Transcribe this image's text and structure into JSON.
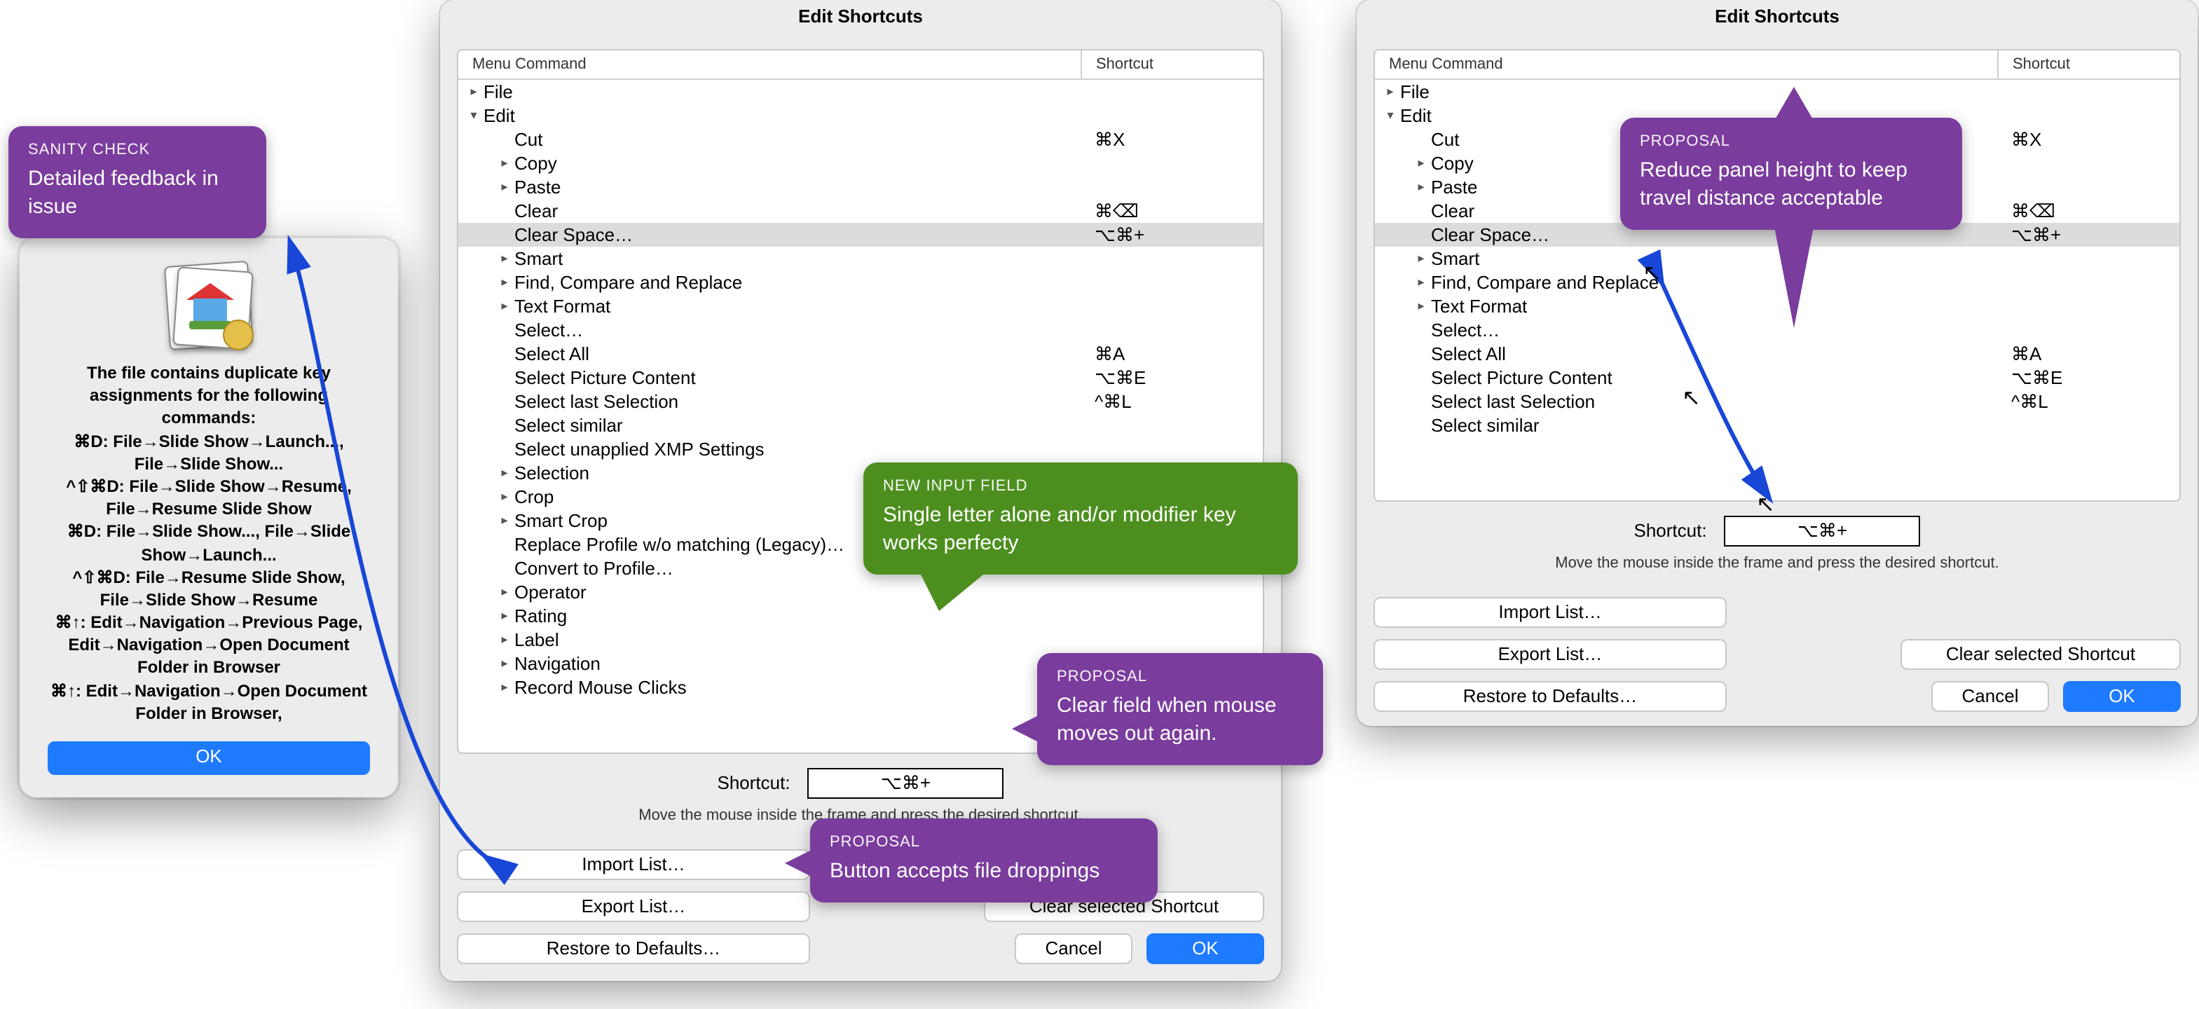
{
  "window_title": "Edit Shortcuts",
  "columns": {
    "menu": "Menu Command",
    "shortcut": "Shortcut"
  },
  "shortcut_label": "Shortcut:",
  "shortcut_value": "⌥⌘+",
  "help_text": "Move the mouse inside the frame and press the desired shortcut.",
  "buttons": {
    "import": "Import List…",
    "export": "Export List…",
    "restore": "Restore to Defaults…",
    "clear_sel": "Clear selected Shortcut",
    "cancel": "Cancel",
    "ok": "OK"
  },
  "tree_full": [
    {
      "d": 0,
      "t": "r",
      "l": "File",
      "sc": ""
    },
    {
      "d": 0,
      "t": "d",
      "l": "Edit",
      "sc": ""
    },
    {
      "d": 1,
      "t": "",
      "l": "Cut",
      "sc": "⌘X"
    },
    {
      "d": 1,
      "t": "r",
      "l": "Copy",
      "sc": ""
    },
    {
      "d": 1,
      "t": "r",
      "l": "Paste",
      "sc": ""
    },
    {
      "d": 1,
      "t": "",
      "l": "Clear",
      "sc": "⌘⌫"
    },
    {
      "d": 1,
      "t": "",
      "l": "Clear Space…",
      "sc": "⌥⌘+",
      "sel": true
    },
    {
      "d": 1,
      "t": "r",
      "l": "Smart",
      "sc": ""
    },
    {
      "d": 1,
      "t": "r",
      "l": "Find, Compare and Replace",
      "sc": ""
    },
    {
      "d": 1,
      "t": "r",
      "l": "Text Format",
      "sc": ""
    },
    {
      "d": 1,
      "t": "",
      "l": "Select…",
      "sc": ""
    },
    {
      "d": 1,
      "t": "",
      "l": "Select All",
      "sc": "⌘A"
    },
    {
      "d": 1,
      "t": "",
      "l": "Select Picture Content",
      "sc": "⌥⌘E"
    },
    {
      "d": 1,
      "t": "",
      "l": "Select last Selection",
      "sc": "^⌘L"
    },
    {
      "d": 1,
      "t": "",
      "l": "Select similar",
      "sc": ""
    },
    {
      "d": 1,
      "t": "",
      "l": "Select unapplied XMP Settings",
      "sc": ""
    },
    {
      "d": 1,
      "t": "r",
      "l": "Selection",
      "sc": ""
    },
    {
      "d": 1,
      "t": "r",
      "l": "Crop",
      "sc": ""
    },
    {
      "d": 1,
      "t": "r",
      "l": "Smart Crop",
      "sc": ""
    },
    {
      "d": 1,
      "t": "",
      "l": "Replace Profile w/o matching (Legacy)…",
      "sc": ""
    },
    {
      "d": 1,
      "t": "",
      "l": "Convert to Profile…",
      "sc": ""
    },
    {
      "d": 1,
      "t": "r",
      "l": "Operator",
      "sc": ""
    },
    {
      "d": 1,
      "t": "r",
      "l": "Rating",
      "sc": ""
    },
    {
      "d": 1,
      "t": "r",
      "l": "Label",
      "sc": ""
    },
    {
      "d": 1,
      "t": "r",
      "l": "Navigation",
      "sc": ""
    },
    {
      "d": 1,
      "t": "r",
      "l": "Record Mouse Clicks",
      "sc": ""
    }
  ],
  "alert": {
    "heading": "The file contains duplicate key assignments for the following commands:",
    "body": "⌘D: File→Slide Show→Launch..., File→Slide Show...\n^⇧⌘D: File→Slide Show→Resume, File→Resume Slide Show\n⌘D: File→Slide Show..., File→Slide Show→Launch...\n^⇧⌘D: File→Resume Slide Show, File→Slide Show→Resume\n⌘↑: Edit→Navigation→Previous Page, Edit→Navigation→Open Document Folder in Browser\n⌘↑: Edit→Navigation→Open Document Folder in Browser,",
    "ok": "OK"
  },
  "callouts": {
    "sanity": {
      "title": "SANITY CHECK",
      "body": "Detailed feedback in issue"
    },
    "newinput": {
      "title": "NEW INPUT FIELD",
      "body": "Single letter alone and/or modifier key works perfecty"
    },
    "clear": {
      "title": "PROPOSAL",
      "body": "Clear field when mouse moves out again."
    },
    "drop": {
      "title": "PROPOSAL",
      "body": "Button accepts file droppings"
    },
    "height": {
      "title": "PROPOSAL",
      "body": "Reduce panel height to keep travel distance acceptable"
    }
  }
}
